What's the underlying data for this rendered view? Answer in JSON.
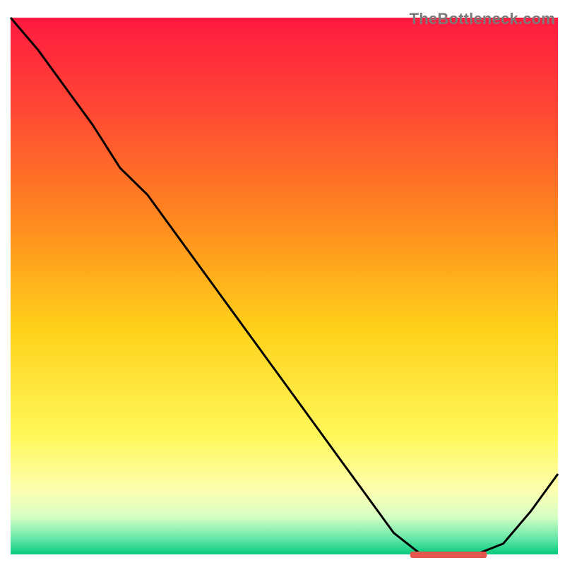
{
  "watermark": "TheBottleneck.com",
  "chart_data": {
    "type": "line",
    "title": "",
    "xlabel": "",
    "ylabel": "",
    "axes_visible": false,
    "plot_extent": {
      "x": [
        15,
        790
      ],
      "y_top": 25,
      "y_bottom": 785
    },
    "gradient_stops": [
      {
        "pos": 0.0,
        "color": "#ff1a40"
      },
      {
        "pos": 0.18,
        "color": "#ff4a33"
      },
      {
        "pos": 0.38,
        "color": "#ff8a1f"
      },
      {
        "pos": 0.58,
        "color": "#ffd11a"
      },
      {
        "pos": 0.78,
        "color": "#fff85a"
      },
      {
        "pos": 0.88,
        "color": "#fdffb0"
      },
      {
        "pos": 0.93,
        "color": "#d6ffc4"
      },
      {
        "pos": 0.97,
        "color": "#66e8a8"
      },
      {
        "pos": 1.0,
        "color": "#06c97e"
      }
    ],
    "x": [
      0.0,
      0.05,
      0.1,
      0.15,
      0.2,
      0.25,
      0.3,
      0.35,
      0.4,
      0.45,
      0.5,
      0.55,
      0.6,
      0.65,
      0.7,
      0.75,
      0.8,
      0.85,
      0.9,
      0.95,
      1.0
    ],
    "series": [
      {
        "name": "curve",
        "color": "#000000",
        "values": [
          100,
          94,
          87,
          80,
          72,
          67,
          60,
          53,
          46,
          39,
          32,
          25,
          18,
          11,
          4,
          0,
          0,
          0,
          2,
          8,
          15
        ]
      }
    ],
    "ylim": [
      0,
      100
    ],
    "marker": {
      "x_start": 0.73,
      "x_end": 0.87,
      "y": 0,
      "color": "#e4564b"
    }
  }
}
